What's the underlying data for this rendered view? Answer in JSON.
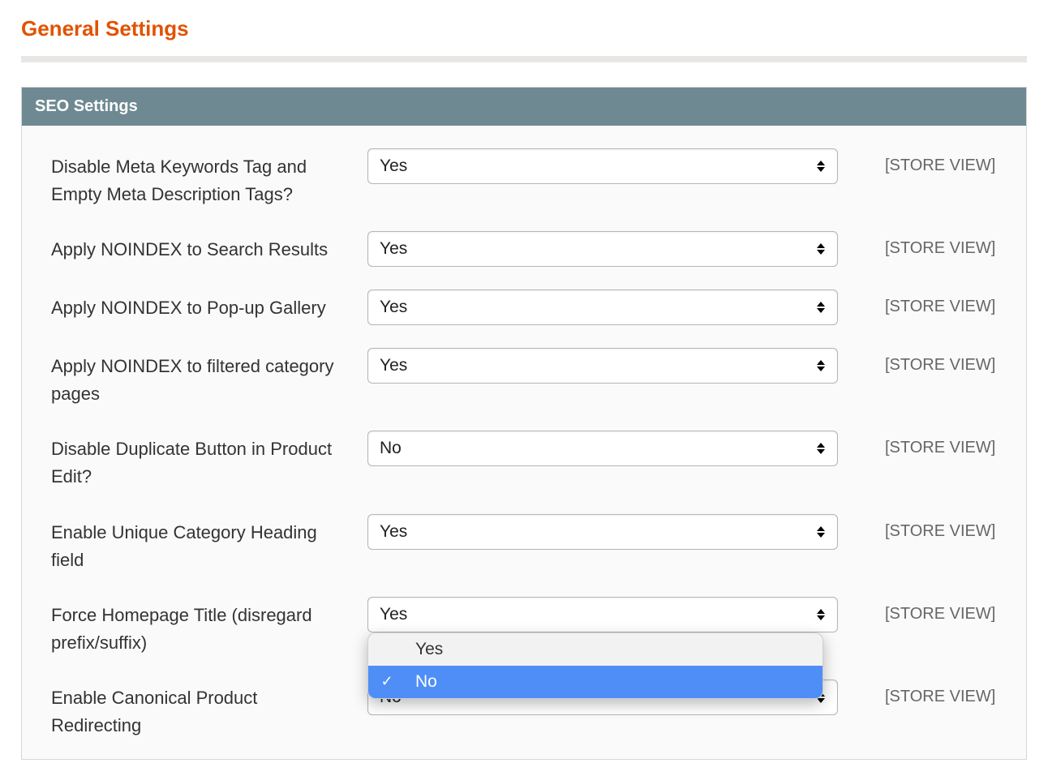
{
  "page_title": "General Settings",
  "section": {
    "title": "SEO Settings",
    "scope_label": "[STORE VIEW]",
    "options": {
      "yes": "Yes",
      "no": "No"
    },
    "fields": [
      {
        "key": "disable_meta_keywords",
        "label": "Disable Meta Keywords Tag and Empty Meta Description Tags?",
        "value": "Yes",
        "scope": "[STORE VIEW]"
      },
      {
        "key": "noindex_search",
        "label": "Apply NOINDEX to Search Results",
        "value": "Yes",
        "scope": "[STORE VIEW]"
      },
      {
        "key": "noindex_popup_gallery",
        "label": "Apply NOINDEX to Pop-up Gallery",
        "value": "Yes",
        "scope": "[STORE VIEW]"
      },
      {
        "key": "noindex_filtered_category",
        "label": "Apply NOINDEX to filtered category pages",
        "value": "Yes",
        "scope": "[STORE VIEW]"
      },
      {
        "key": "disable_duplicate_button",
        "label": "Disable Duplicate Button in Product Edit?",
        "value": "No",
        "scope": "[STORE VIEW]"
      },
      {
        "key": "unique_category_heading",
        "label": "Enable Unique Category Heading field",
        "value": "Yes",
        "scope": "[STORE VIEW]"
      },
      {
        "key": "force_homepage_title",
        "label": "Force Homepage Title (disregard prefix/suffix)",
        "value": "Yes",
        "scope": "[STORE VIEW]"
      },
      {
        "key": "canonical_product_redirecting",
        "label": "Enable Canonical Product Redirecting",
        "value": "No",
        "scope": "[STORE VIEW]",
        "dropdown_open": true,
        "dropdown_selected": "No"
      }
    ]
  }
}
